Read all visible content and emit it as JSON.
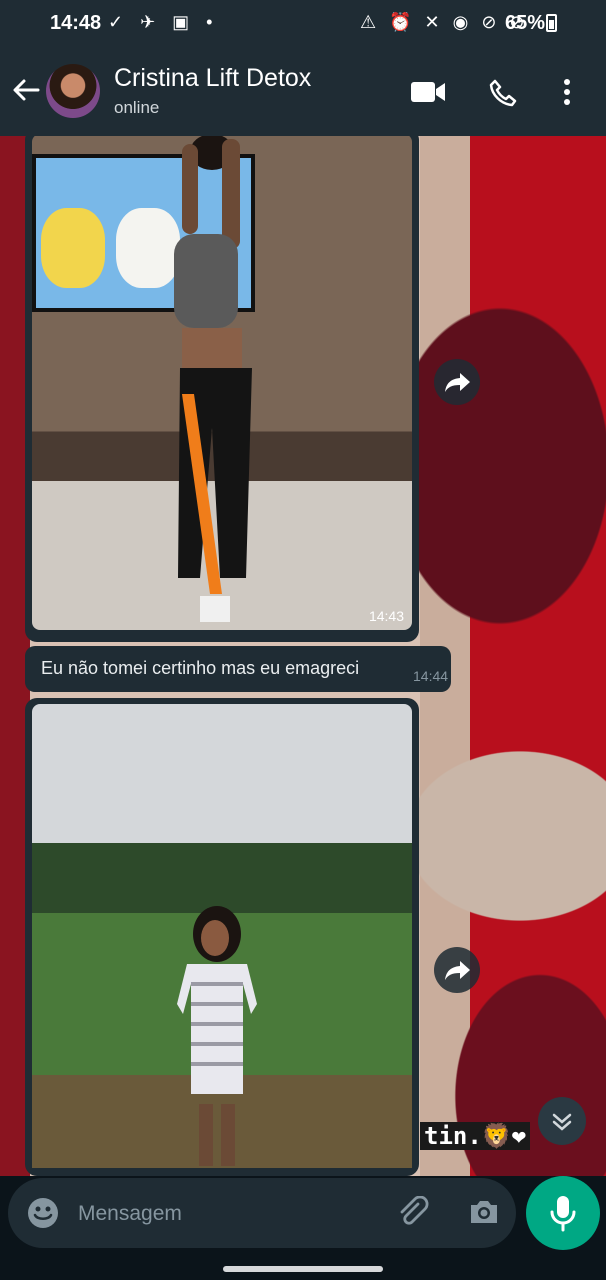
{
  "status_bar": {
    "time": "14:48",
    "left_icons": "✓ ✈ ▣ •",
    "right_icons": "⚠ ⏰ ✕ ◉ ⊘ ⊘",
    "battery": "65%"
  },
  "header": {
    "contact_name": "Cristina Lift Detox",
    "status": "online",
    "icons": [
      "back-arrow-icon",
      "video-call-icon",
      "phone-icon",
      "more-vert-icon"
    ]
  },
  "messages": [
    {
      "type": "image",
      "time": "14:43"
    },
    {
      "type": "text",
      "text": "Eu não tomei certinho mas eu emagreci",
      "time": "14:44"
    },
    {
      "type": "image",
      "time": ""
    }
  ],
  "wallpaper_text": "tin.🦁❤",
  "composer": {
    "placeholder": "Mensagem",
    "icons": [
      "emoji-icon",
      "attach-icon",
      "camera-icon",
      "mic-icon"
    ]
  },
  "colors": {
    "bar": "#1f2c34",
    "accent": "#00a884",
    "bubble": "#1f2c34",
    "muted": "#8696a0"
  }
}
